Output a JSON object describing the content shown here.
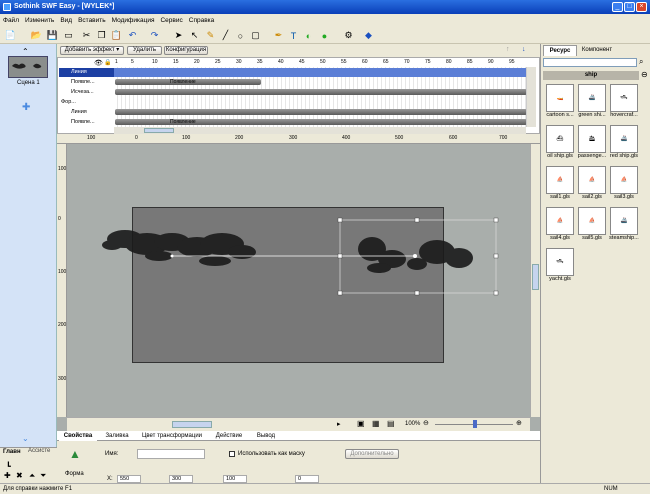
{
  "window": {
    "title": "Sothink SWF Easy - [WYLEK*]"
  },
  "menu": [
    "Файл",
    "Изменить",
    "Вид",
    "Вставить",
    "Модификация",
    "Сервис",
    "Справка"
  ],
  "scene": {
    "label": "Сцена 1",
    "tabs": [
      "Главн",
      "Ассисте"
    ]
  },
  "timeline": {
    "buttons": {
      "add_effect": "Добавить эффект",
      "delete": "Удалить",
      "config": "Конфигурация"
    },
    "frame_numbers": [
      "1",
      "5",
      "10",
      "15",
      "20",
      "25",
      "30",
      "35",
      "40",
      "45",
      "50",
      "55",
      "60",
      "65",
      "70",
      "75",
      "80",
      "85",
      "90",
      "95"
    ],
    "layers": [
      "Линия",
      "Появле...",
      "Исчеза...",
      "Фор...",
      "Линия",
      "Появле..."
    ],
    "bars": [
      "Появление",
      "Появление"
    ]
  },
  "ruler": {
    "h": [
      "100",
      "0",
      "100",
      "200",
      "300",
      "400",
      "500",
      "600",
      "700"
    ],
    "v": [
      "100",
      "0",
      "100",
      "200",
      "300"
    ]
  },
  "zoom": "100%",
  "right": {
    "tabs": [
      "Ресурс",
      "Компонент"
    ],
    "folder": "ship",
    "assets": [
      "cartoon s...",
      "green shi...",
      "hovercraf...",
      "oil ship.gls",
      "passenge...",
      "red ship.gls",
      "sail1.gls",
      "sail2.gls",
      "sail3.gls",
      "sail4.gls",
      "sail5.gls",
      "steamship...",
      "yacht.gls"
    ]
  },
  "props": {
    "tabs": [
      "Свойства",
      "Заливка",
      "Цвет трансформации",
      "Действие",
      "Вывод"
    ],
    "name_label": "Имя:",
    "use_mask": "Использовать как маску",
    "more": "Дополнительно",
    "shape_label": "Форма",
    "x_label": "X:",
    "x_val": "550",
    "w_val": "300",
    "h_val": "100",
    "y_val": "0"
  },
  "status": {
    "help": "Для справки нажмите F1",
    "num": "NUM"
  }
}
